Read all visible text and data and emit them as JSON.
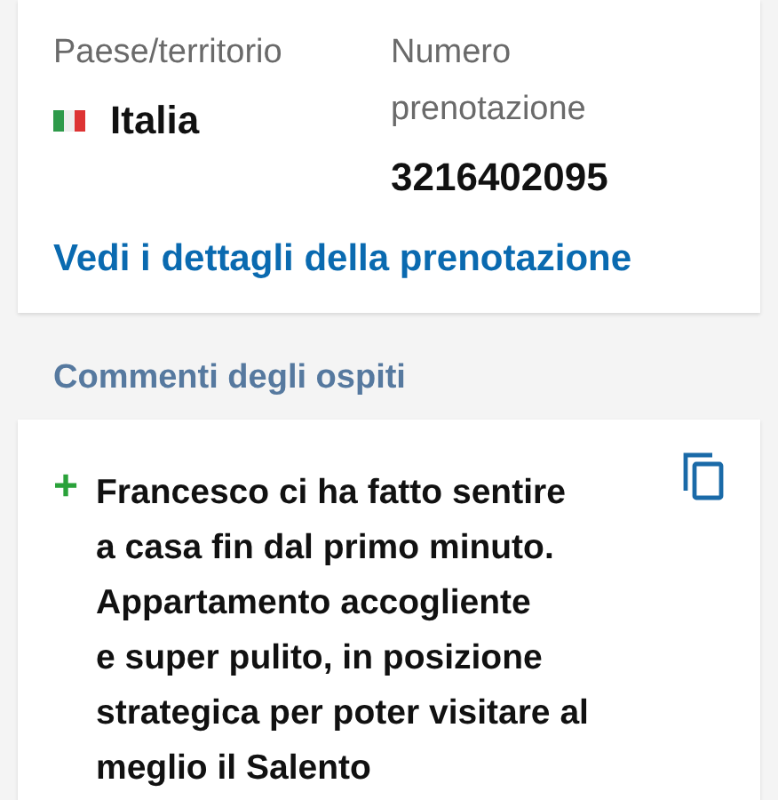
{
  "booking_card": {
    "fields": [
      {
        "label": "Paese/territorio",
        "value": "Italia",
        "kind": "country"
      },
      {
        "label": "Numero prenotazione",
        "value": "3216402095",
        "kind": "text"
      }
    ],
    "link": "Vedi i dettagli della prenotazione"
  },
  "comments": {
    "title": "Commenti degli ospiti",
    "sign": "+",
    "lines": [
      "Francesco ci ha fatto sentire",
      "a casa fin dal primo minuto.",
      "Appartamento accogliente",
      "e super pulito, in posizione",
      "strategica per poter visitare al",
      "meglio il Salento"
    ]
  }
}
